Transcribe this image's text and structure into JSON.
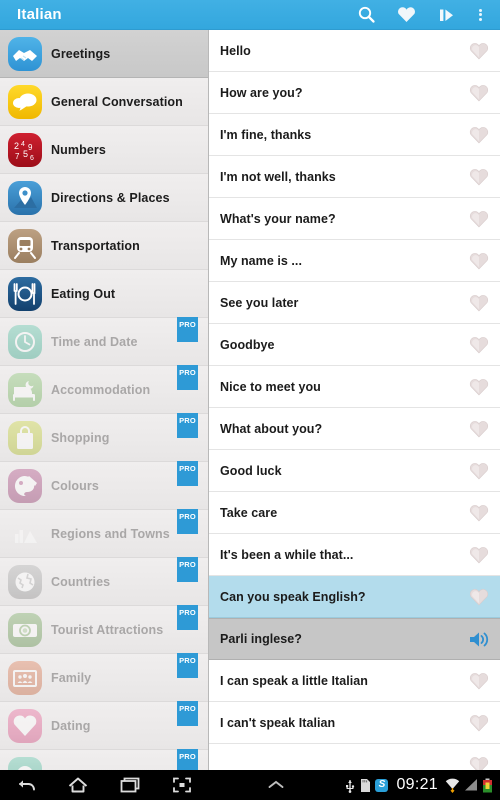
{
  "actionbar": {
    "title": "Italian",
    "actions": [
      {
        "name": "search-icon",
        "label": "Search"
      },
      {
        "name": "favorites-icon",
        "label": "Favorites"
      },
      {
        "name": "slideshow-icon",
        "label": "Slideshow"
      },
      {
        "name": "overflow-menu-icon",
        "label": "More options"
      }
    ]
  },
  "sidebar": {
    "items": [
      {
        "label": "Greetings",
        "icon": "handshake-icon",
        "color": "#4fb3e8",
        "color2": "#2f93d4",
        "selected": true,
        "pro": false
      },
      {
        "label": "General Conversation",
        "icon": "speech-bubble-icon",
        "color": "#ffd92b",
        "color2": "#f0b800",
        "selected": false,
        "pro": false
      },
      {
        "label": "Numbers",
        "icon": "numbers-icon",
        "color": "#cf2030",
        "color2": "#9c0d18",
        "selected": false,
        "pro": false
      },
      {
        "label": "Directions & Places",
        "icon": "map-pin-icon",
        "color": "#4a9fd8",
        "color2": "#2a72ab",
        "selected": false,
        "pro": false
      },
      {
        "label": "Transportation",
        "icon": "train-icon",
        "color": "#bda183",
        "color2": "#9b7f60",
        "selected": false,
        "pro": false
      },
      {
        "label": "Eating Out",
        "icon": "cutlery-icon",
        "color": "#2d6ca0",
        "color2": "#12406d",
        "selected": false,
        "pro": false
      },
      {
        "label": "Time and Date",
        "icon": "clock-icon",
        "color": "#66c9ae",
        "color2": "#3aab8e",
        "selected": false,
        "pro": true
      },
      {
        "label": "Accommodation",
        "icon": "bed-icon",
        "color": "#8fc97a",
        "color2": "#6cae56",
        "selected": false,
        "pro": true
      },
      {
        "label": "Shopping",
        "icon": "shopping-bag-icon",
        "color": "#cdd84a",
        "color2": "#aebd26",
        "selected": false,
        "pro": true
      },
      {
        "label": "Colours",
        "icon": "palette-icon",
        "color": "#b4558c",
        "color2": "#94386d",
        "selected": false,
        "pro": true
      },
      {
        "label": "Regions and Towns",
        "icon": "landscape-icon",
        "color": "#f0a košice",
        "color2": "#e08a3c",
        "selected": false,
        "pro": true
      },
      {
        "label": "Countries",
        "icon": "globe-icon",
        "color": "#b4b4b4",
        "color2": "#939393",
        "selected": false,
        "pro": true
      },
      {
        "label": "Tourist Attractions",
        "icon": "camera-icon",
        "color": "#7fae68",
        "color2": "#5e8f48",
        "selected": false,
        "pro": true
      },
      {
        "label": "Family",
        "icon": "family-photo-icon",
        "color": "#e0845f",
        "color2": "#c8663f",
        "selected": false,
        "pro": true
      },
      {
        "label": "Dating",
        "icon": "heart-icon",
        "color": "#ec6fa0",
        "color2": "#d44b81",
        "selected": false,
        "pro": true
      },
      {
        "label": "",
        "icon": "partial-icon",
        "color": "#66c9ae",
        "color2": "#3aab8e",
        "selected": false,
        "pro": true
      }
    ]
  },
  "phrases": {
    "rows": [
      {
        "text": "Hello",
        "state": "normal",
        "action": "favorite-icon"
      },
      {
        "text": "How are you?",
        "state": "normal",
        "action": "favorite-icon"
      },
      {
        "text": "I'm fine, thanks",
        "state": "normal",
        "action": "favorite-icon"
      },
      {
        "text": "I'm not well, thanks",
        "state": "normal",
        "action": "favorite-icon"
      },
      {
        "text": "What's your name?",
        "state": "normal",
        "action": "favorite-icon"
      },
      {
        "text": "My name is ...",
        "state": "normal",
        "action": "favorite-icon"
      },
      {
        "text": "See you later",
        "state": "normal",
        "action": "favorite-icon"
      },
      {
        "text": "Goodbye",
        "state": "normal",
        "action": "favorite-icon"
      },
      {
        "text": "Nice to meet you",
        "state": "normal",
        "action": "favorite-icon"
      },
      {
        "text": "What about you?",
        "state": "normal",
        "action": "favorite-icon"
      },
      {
        "text": "Good luck",
        "state": "normal",
        "action": "favorite-icon"
      },
      {
        "text": "Take care",
        "state": "normal",
        "action": "favorite-icon"
      },
      {
        "text": "It's been a while that...",
        "state": "normal",
        "action": "favorite-icon"
      },
      {
        "text": "Can you speak English?",
        "state": "selected",
        "action": "favorite-icon"
      },
      {
        "text": "Parli inglese?",
        "state": "translation",
        "action": "speaker-icon"
      },
      {
        "text": "I can speak a little Italian",
        "state": "normal",
        "action": "favorite-icon"
      },
      {
        "text": "I can't speak Italian",
        "state": "normal",
        "action": "favorite-icon"
      },
      {
        "text": "",
        "state": "normal",
        "action": "favorite-icon"
      }
    ]
  },
  "navbar": {
    "buttons": [
      {
        "name": "back-button",
        "label": "Back"
      },
      {
        "name": "home-button",
        "label": "Home"
      },
      {
        "name": "recents-button",
        "label": "Recent apps"
      },
      {
        "name": "screenshot-button",
        "label": "Screenshot"
      },
      {
        "name": "expand-button",
        "label": "Show notifications"
      }
    ],
    "status": {
      "clock": "09:21",
      "icons": [
        "usb-icon",
        "sd-card-icon",
        "skype-icon",
        "wifi-icon",
        "signal-icon",
        "battery-icon"
      ],
      "skype_glyph": "S"
    }
  },
  "colors": {
    "accent": "#33a7de",
    "selected_row": "#b3dcec",
    "translation_row": "#c6c6c6",
    "pro_badge": "#2e9ad6"
  }
}
